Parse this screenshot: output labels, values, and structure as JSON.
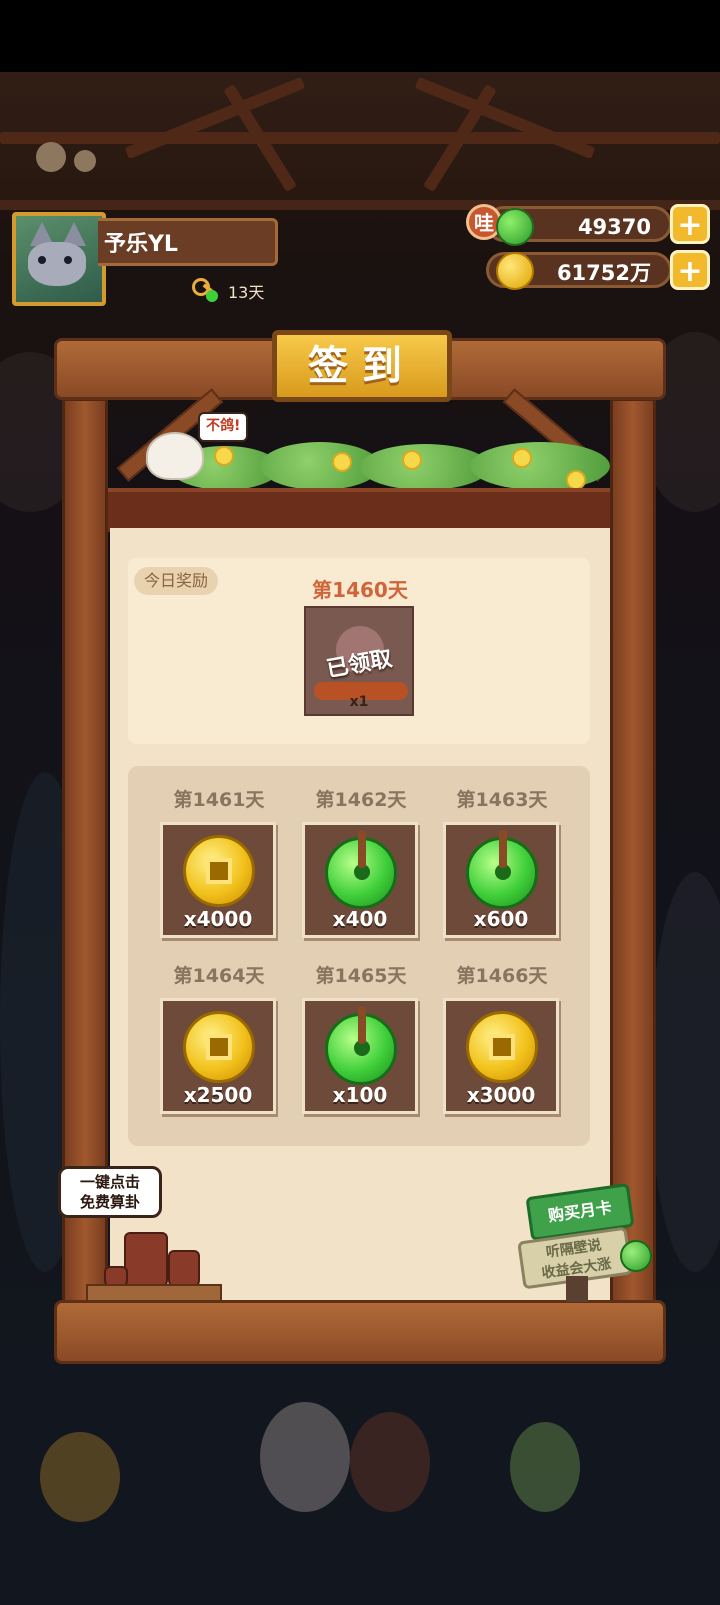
{
  "header": {
    "player_name": "予乐YL",
    "streak_days": "13天",
    "currency_jade": {
      "badge": "哇",
      "amount": "49370",
      "icon": "jade-icon"
    },
    "currency_coin": {
      "amount": "61752万",
      "icon": "coin-icon"
    },
    "plus_symbol": "+"
  },
  "signin": {
    "title": "签到",
    "chick_bubble": "不鸽!",
    "today_label": "今日奖励",
    "today": {
      "day": "第1460天",
      "status": "已领取",
      "qty": "x1"
    },
    "rewards": [
      {
        "day": "第1461天",
        "type": "coin",
        "qty": "x4000"
      },
      {
        "day": "第1462天",
        "type": "jade",
        "qty": "x400"
      },
      {
        "day": "第1463天",
        "type": "jade",
        "qty": "x600"
      },
      {
        "day": "第1464天",
        "type": "coin",
        "qty": "x2500"
      },
      {
        "day": "第1465天",
        "type": "jade",
        "qty": "x100"
      },
      {
        "day": "第1466天",
        "type": "coin",
        "qty": "x3000"
      }
    ],
    "fortune_bubble_line1": "一键点击",
    "fortune_bubble_line2": "免费算卦",
    "month_card": {
      "title": "购买月卡",
      "sub_line1": "听隔壁说",
      "sub_line2": "收益会大涨"
    }
  },
  "colors": {
    "title_gold": "#f2b92c",
    "wood": "#8a4a26",
    "day_highlight": "#d0643a",
    "panel_bg": "#f1e2c8"
  }
}
